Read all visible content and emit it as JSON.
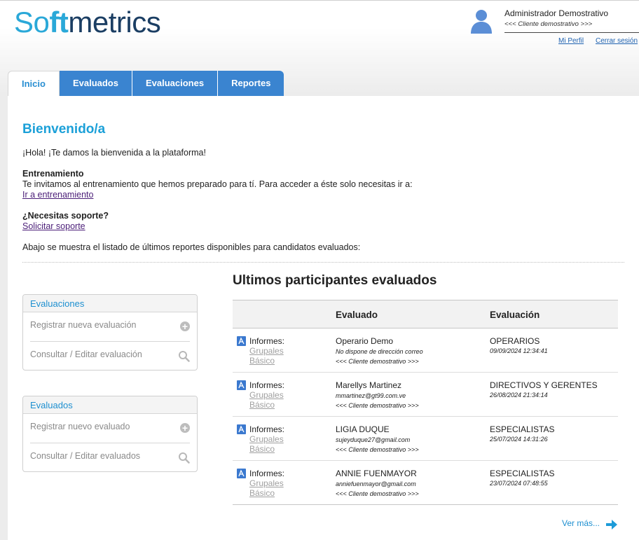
{
  "brand": {
    "logo_part1": "S",
    "logo_part2": "o",
    "logo_part3": "ft",
    "logo_part4": "metrics",
    "primary_color": "#2aa8d8",
    "dark_color": "#1b3e63"
  },
  "user": {
    "name": "Administrador Demostrativo",
    "client": "<<< Cliente demostrativo >>>",
    "profile_link": "Mi Perfil",
    "logout_link": "Cerrar sesión"
  },
  "tabs": [
    {
      "label": "Inicio",
      "active": true
    },
    {
      "label": "Evaluados",
      "active": false
    },
    {
      "label": "Evaluaciones",
      "active": false
    },
    {
      "label": "Reportes",
      "active": false
    }
  ],
  "welcome": {
    "title": "Bienvenido/a",
    "greeting": "¡Hola! ¡Te damos la bienvenida a la plataforma!",
    "training_heading": "Entrenamiento",
    "training_text": "Te invitamos al entrenamiento que hemos preparado para tí. Para acceder a éste solo necesitas ir a:",
    "training_link": "Ir a entrenamiento",
    "support_heading": "¿Necesitas soporte?",
    "support_link": "Solicitar soporte",
    "list_intro": "Abajo se muestra el listado de últimos reportes disponibles para candidatos evaluados:"
  },
  "sidebar": {
    "evaluaciones": {
      "title": "Evaluaciones",
      "items": [
        "Registrar nueva evaluación",
        "Consultar / Editar evaluación"
      ]
    },
    "evaluados": {
      "title": "Evaluados",
      "items": [
        "Registrar nuevo evaluado",
        "Consultar / Editar evaluados"
      ]
    }
  },
  "table": {
    "title": "Ultimos participantes evaluados",
    "columns": [
      "Evaluado",
      "Evaluación"
    ],
    "informes_label": "Informes:",
    "report_links": [
      "Grupales",
      "Básico"
    ],
    "rows": [
      {
        "name": "Operario Demo",
        "email": "No dispone de dirección correo",
        "client": "<<< Cliente demostrativo >>>",
        "evaluation": "OPERARIOS",
        "date": "09/09/2024 12:34:41"
      },
      {
        "name": "Marellys Martinez",
        "email": "mmartinez@gt99.com.ve",
        "client": "<<< Cliente demostrativo >>>",
        "evaluation": "DIRECTIVOS Y GERENTES",
        "date": "26/08/2024 21:34:14"
      },
      {
        "name": "LIGIA DUQUE",
        "email": "sujeyduque27@gmail.com",
        "client": "<<< Cliente demostrativo >>>",
        "evaluation": "ESPECIALISTAS",
        "date": "25/07/2024 14:31:26"
      },
      {
        "name": "ANNIE FUENMAYOR",
        "email": "anniefuenmayor@gmail.com",
        "client": "<<< Cliente demostrativo >>>",
        "evaluation": "ESPECIALISTAS",
        "date": "23/07/2024 07:48:55"
      }
    ],
    "more_link": "Ver más..."
  }
}
